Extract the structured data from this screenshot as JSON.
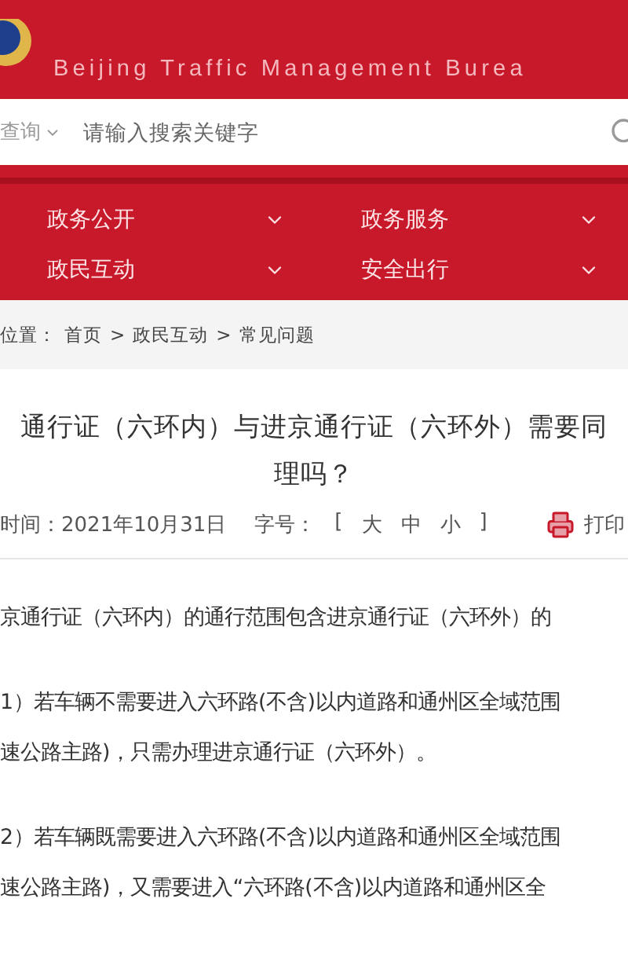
{
  "header": {
    "subtitle": "Beijing Traffic Management Burea"
  },
  "search": {
    "scope": "查询",
    "placeholder": "请输入搜索关键字"
  },
  "nav": [
    {
      "label": "政务公开"
    },
    {
      "label": "政务服务"
    },
    {
      "label": "政民互动"
    },
    {
      "label": "安全出行"
    }
  ],
  "breadcrumb": {
    "prefix": "位置：",
    "items": [
      "首页",
      "政民互动",
      "常见问题"
    ],
    "separator": ">"
  },
  "article": {
    "title_lines": [
      "通行证（六环内）与进京通行证（六环外）需要同",
      "理吗？"
    ],
    "date": "时间：2021年10月31日",
    "font_label": "字号：",
    "bracket_open": "[",
    "font_sizes": [
      "大",
      "中",
      "小"
    ],
    "bracket_close": "]",
    "print": "打印",
    "paragraphs": [
      [
        "京通行证（六环内）的通行范围包含进京通行证（六环外）的"
      ],
      [
        "1）若车辆不需要进入六环路(不含)以内道路和通州区全域范围",
        "速公路主路)，只需办理进京通行证（六环外）。"
      ],
      [
        "2）若车辆既需要进入六环路(不含)以内道路和通州区全域范围",
        "速公路主路)，又需要进入“六环路(不含)以内道路和通州区全"
      ]
    ]
  }
}
